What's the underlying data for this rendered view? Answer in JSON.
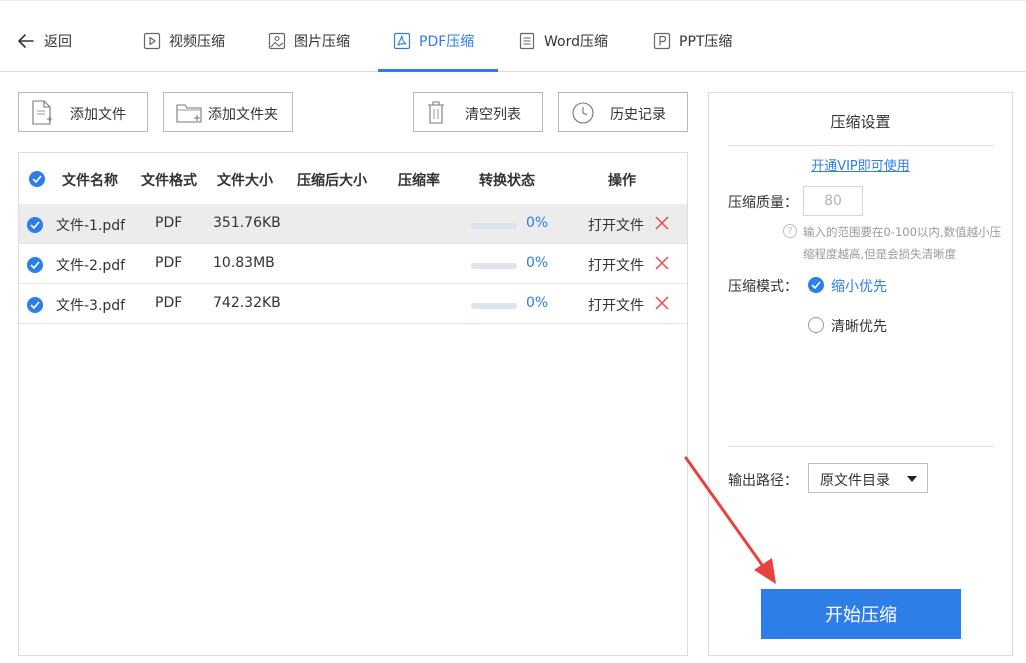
{
  "nav": {
    "back_label": "返回",
    "tabs": [
      {
        "label": "视频压缩",
        "icon": "video-icon"
      },
      {
        "label": "图片压缩",
        "icon": "image-icon"
      },
      {
        "label": "PDF压缩",
        "icon": "pdf-icon",
        "active": true
      },
      {
        "label": "Word压缩",
        "icon": "word-icon"
      },
      {
        "label": "PPT压缩",
        "icon": "ppt-icon"
      }
    ]
  },
  "toolbar": {
    "add_file": "添加文件",
    "add_folder": "添加文件夹",
    "clear_list": "清空列表",
    "history": "历史记录"
  },
  "table": {
    "headers": [
      "文件名称",
      "文件格式",
      "文件大小",
      "压缩后大小",
      "压缩率",
      "转换状态",
      "操作"
    ],
    "rows": [
      {
        "name": "文件-1.pdf",
        "format": "PDF",
        "size": "351.76KB",
        "compressed_size": "",
        "ratio": "",
        "progress_percent": 0,
        "status": "0%",
        "action": "打开文件"
      },
      {
        "name": "文件-2.pdf",
        "format": "PDF",
        "size": "10.83MB",
        "compressed_size": "",
        "ratio": "",
        "progress_percent": 0,
        "status": "0%",
        "action": "打开文件"
      },
      {
        "name": "文件-3.pdf",
        "format": "PDF",
        "size": "742.32KB",
        "compressed_size": "",
        "ratio": "",
        "progress_percent": 0,
        "status": "0%",
        "action": "打开文件"
      }
    ]
  },
  "settings": {
    "title": "压缩设置",
    "vip_link": "开通VIP即可使用",
    "quality_label": "压缩质量：",
    "quality_value": "80",
    "hint": "输入的范围要在0-100以内,数值越小压缩程度越高,但是会损失清晰度",
    "mode_label": "压缩模式：",
    "modes": [
      {
        "label": "缩小优先",
        "selected": true
      },
      {
        "label": "清晰优先",
        "selected": false
      }
    ],
    "output_label": "输出路径：",
    "output_value": "原文件目录",
    "start_button": "开始压缩"
  },
  "colors": {
    "accent": "#2d7ee6",
    "delete": "#e84a4a",
    "annotation_arrow": "#e8423f"
  }
}
